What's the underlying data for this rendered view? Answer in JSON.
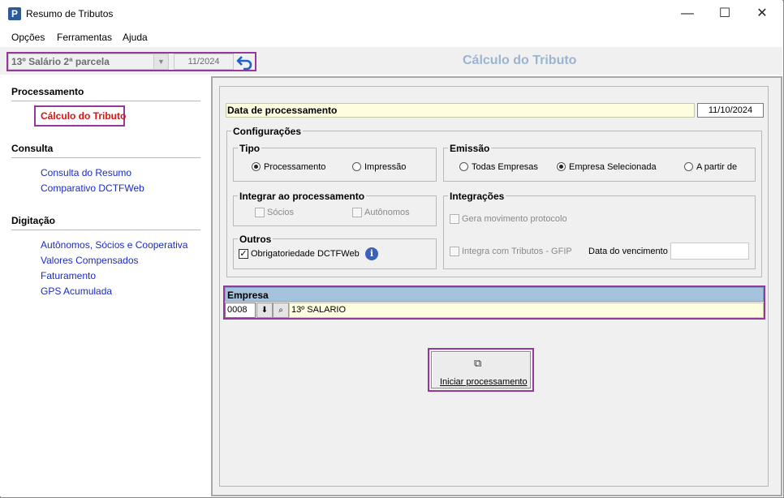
{
  "window": {
    "title": "Resumo de Tributos",
    "icon_letter": "P",
    "minimize": "—",
    "maximize": "☐",
    "close": "✕"
  },
  "menu": [
    "Opções",
    "Ferramentas",
    "Ajuda"
  ],
  "toolbar": {
    "payroll_type": "13º Salário 2ª parcela",
    "period": "11/2024",
    "heading": "Cálculo do Tributo"
  },
  "sidebar": {
    "sections": [
      {
        "title": "Processamento",
        "items": [
          "Cálculo do Tributo"
        ]
      },
      {
        "title": "Consulta",
        "items": [
          "Consulta do Resumo",
          "Comparativo DCTFWeb"
        ]
      },
      {
        "title": "Digitação",
        "items": [
          "Autônomos, Sócios e Cooperativa",
          "Valores Compensados",
          "Faturamento",
          "GPS Acumulada"
        ]
      }
    ]
  },
  "form": {
    "date_label": "Data de processamento",
    "date_value": "11/10/2024",
    "configuracoes": "Configurações",
    "tipo": {
      "title": "Tipo",
      "options": [
        "Processamento",
        "Impressão"
      ],
      "selected": "Processamento"
    },
    "emissao": {
      "title": "Emissão",
      "options": [
        "Todas Empresas",
        "Empresa Selecionada",
        "A partir de"
      ],
      "selected": "Empresa Selecionada"
    },
    "integrar": {
      "title": "Integrar ao processamento",
      "options": [
        "Sócios",
        "Autônomos"
      ]
    },
    "integracoes": {
      "title": "Integrações",
      "gera_mov": "Gera movimento protocolo",
      "integra_gfip": "Integra com Tributos - GFIP",
      "venc_label": "Data do vencimento"
    },
    "outros": {
      "title": "Outros",
      "dctfweb": "Obrigatoriedade DCTFWeb",
      "dctfweb_checked": true
    }
  },
  "empresa": {
    "header": "Empresa",
    "code": "0008",
    "name": "13º SALARIO"
  },
  "action": {
    "label": "Iniciar processamento"
  },
  "colors": {
    "accent_highlight": "#93399a",
    "active_link": "#e01010",
    "link": "#1a2bc5",
    "heading": "#9bb4cf"
  }
}
